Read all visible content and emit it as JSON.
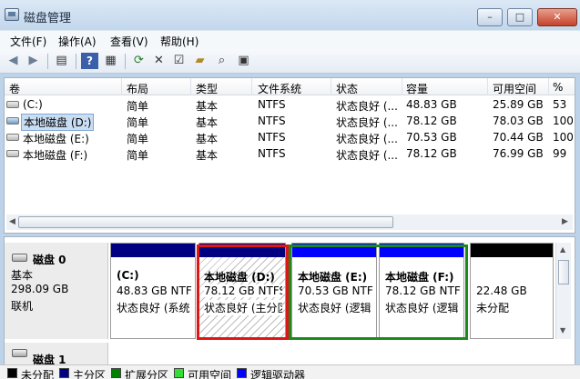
{
  "window": {
    "title": "磁盘管理",
    "min": "–",
    "max": "□",
    "close": "✕"
  },
  "menu": [
    "文件(F)",
    "操作(A)",
    "查看(V)",
    "帮助(H)"
  ],
  "toolbar_icons": [
    "back-icon",
    "forward-icon",
    "console-tree-icon",
    "help-icon",
    "properties-pane-icon",
    "refresh-icon",
    "delete-icon",
    "properties-icon",
    "open-icon",
    "explore-icon",
    "settings-icon"
  ],
  "columns": [
    "卷",
    "布局",
    "类型",
    "文件系统",
    "状态",
    "容量",
    "可用空间",
    "%"
  ],
  "volumes": [
    {
      "name": "(C:)",
      "layout": "简单",
      "type": "基本",
      "fs": "NTFS",
      "status": "状态良好 (...",
      "capacity": "48.83 GB",
      "free": "25.89 GB",
      "pct": "53"
    },
    {
      "name": "本地磁盘 (D:)",
      "layout": "简单",
      "type": "基本",
      "fs": "NTFS",
      "status": "状态良好 (...",
      "capacity": "78.12 GB",
      "free": "78.03 GB",
      "pct": "100"
    },
    {
      "name": "本地磁盘 (E:)",
      "layout": "简单",
      "type": "基本",
      "fs": "NTFS",
      "status": "状态良好 (...",
      "capacity": "70.53 GB",
      "free": "70.44 GB",
      "pct": "100"
    },
    {
      "name": "本地磁盘 (F:)",
      "layout": "简单",
      "type": "基本",
      "fs": "NTFS",
      "status": "状态良好 (...",
      "capacity": "78.12 GB",
      "free": "76.99 GB",
      "pct": "99"
    }
  ],
  "disk0": {
    "label": "磁盘 0",
    "type": "基本",
    "size": "298.09 GB",
    "state": "联机"
  },
  "disk1": {
    "label": "磁盘 1"
  },
  "partitions": [
    {
      "title": "(C:)",
      "line2": "48.83 GB NTF",
      "line3": "状态良好 (系统",
      "bar_color": "#000080"
    },
    {
      "title": "本地磁盘 (D:)",
      "line2": "78.12 GB NTFS",
      "line3": "状态良好 (主分区",
      "bar_color": "#000080"
    },
    {
      "title": "本地磁盘 (E:)",
      "line2": "70.53 GB NTF",
      "line3": "状态良好 (逻辑",
      "bar_color": "#0000ff"
    },
    {
      "title": "本地磁盘 (F:)",
      "line2": "78.12 GB NTF",
      "line3": "状态良好 (逻辑",
      "bar_color": "#0000ff"
    },
    {
      "title": "",
      "line2": "22.48 GB",
      "line3": "未分配",
      "bar_color": "#000000"
    }
  ],
  "legend": [
    {
      "label": "未分配",
      "color": "#000000"
    },
    {
      "label": "主分区",
      "color": "#000080"
    },
    {
      "label": "扩展分区",
      "color": "#008000"
    },
    {
      "label": "可用空间",
      "color": "#33dd33"
    },
    {
      "label": "逻辑驱动器",
      "color": "#0000ff"
    }
  ]
}
